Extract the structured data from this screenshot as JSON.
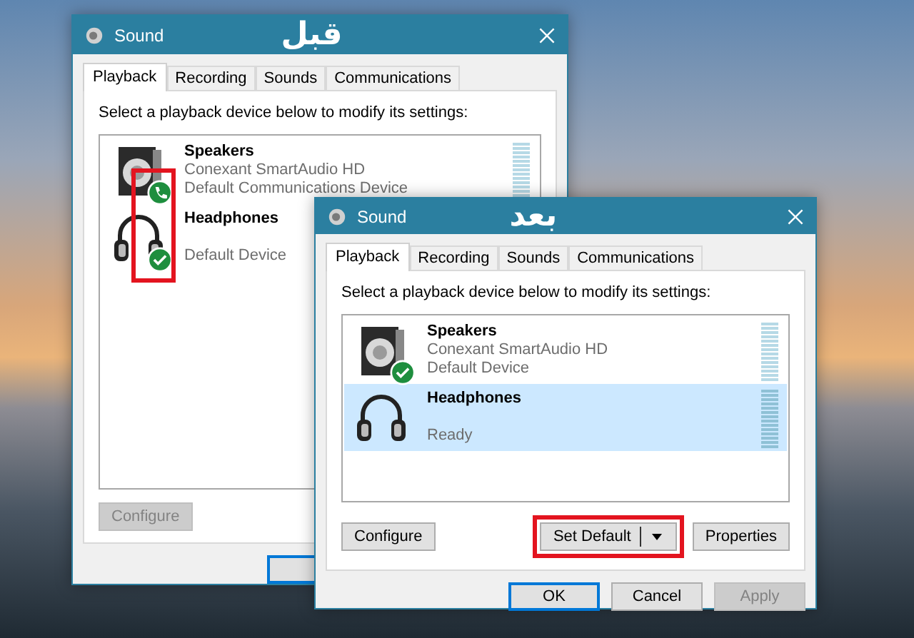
{
  "windows": [
    {
      "title": "Sound",
      "annotation": "قبل",
      "badge_highlight": true,
      "tabs": [
        {
          "label": "Playback",
          "selected": true
        },
        {
          "label": "Recording",
          "selected": false
        },
        {
          "label": "Sounds",
          "selected": false
        },
        {
          "label": "Communications",
          "selected": false
        }
      ],
      "instruction": "Select a playback device below to modify its settings:",
      "devices": [
        {
          "kind": "speaker",
          "badge": {
            "kind": "phone"
          },
          "name": "Speakers",
          "description": "Conexant SmartAudio HD",
          "status": "Default Communications Device"
        },
        {
          "kind": "headphones",
          "badge": {
            "kind": "check"
          },
          "name": "Headphones",
          "status": "Default Device"
        }
      ],
      "buttons": [
        {
          "label": "Configure",
          "kind": "plain",
          "disabled": true,
          "highlighted": false
        }
      ],
      "dialog_buttons": [
        {
          "default": true,
          "disabled": false
        }
      ]
    },
    {
      "title": "Sound",
      "annotation": "بعد",
      "tabs": [
        {
          "label": "Playback",
          "selected": true
        },
        {
          "label": "Recording",
          "selected": false
        },
        {
          "label": "Sounds",
          "selected": false
        },
        {
          "label": "Communications",
          "selected": false
        }
      ],
      "instruction": "Select a playback device below to modify its settings:",
      "devices": [
        {
          "kind": "speaker",
          "badge": {
            "kind": "check"
          },
          "name": "Speakers",
          "description": "Conexant SmartAudio HD",
          "status": "Default Device",
          "selected": false
        },
        {
          "kind": "headphones",
          "name": "Headphones",
          "status": "Ready",
          "selected": true
        }
      ],
      "buttons": [
        {
          "label": "Configure",
          "kind": "plain",
          "disabled": false,
          "highlighted": false
        },
        {
          "label": "Set Default",
          "kind": "split",
          "disabled": false,
          "highlighted": true
        },
        {
          "label": "Properties",
          "kind": "plain",
          "disabled": false,
          "highlighted": false
        }
      ],
      "dialog_buttons": [
        {
          "label": "OK",
          "default": true,
          "disabled": false
        },
        {
          "label": "Cancel",
          "default": false,
          "disabled": false
        },
        {
          "label": "Apply",
          "default": false,
          "disabled": true
        }
      ]
    }
  ]
}
